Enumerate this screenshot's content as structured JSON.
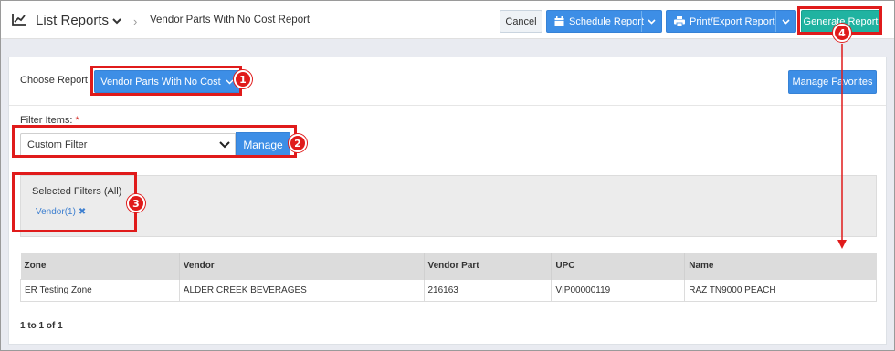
{
  "header": {
    "title": "List Reports",
    "breadcrumb": "Vendor Parts With No Cost Report",
    "buttons": {
      "cancel": "Cancel",
      "schedule": "Schedule Report",
      "print": "Print/Export Report",
      "generate": "Generate Report"
    }
  },
  "choose": {
    "label": "Choose Report",
    "selected": "Vendor Parts With No Cost",
    "manage_favorites": "Manage Favorites"
  },
  "filter": {
    "label": "Filter Items:",
    "required_mark": "*",
    "selected_value": "Custom Filter",
    "manage_label": "Manage"
  },
  "selected_filters": {
    "title": "Selected Filters (All)",
    "tags": [
      "Vendor(1)"
    ],
    "remove_glyph": "✖"
  },
  "table": {
    "columns": [
      "Zone",
      "Vendor",
      "Vendor Part",
      "UPC",
      "Name"
    ],
    "rows": [
      [
        "ER Testing Zone",
        "ALDER CREEK BEVERAGES",
        "216163",
        "VIP00000119",
        "RAZ TN9000 PEACH"
      ]
    ]
  },
  "pager": "1 to 1 of 1",
  "annotations": [
    "1",
    "2",
    "3",
    "4"
  ],
  "colors": {
    "primary": "#3d8ee6",
    "generate": "#20b3a1",
    "annotation": "#e01b1b"
  },
  "icons": [
    "chart-line-icon",
    "chevron-down-icon",
    "calendar-icon",
    "printer-icon",
    "caret-down-icon",
    "close-icon"
  ]
}
